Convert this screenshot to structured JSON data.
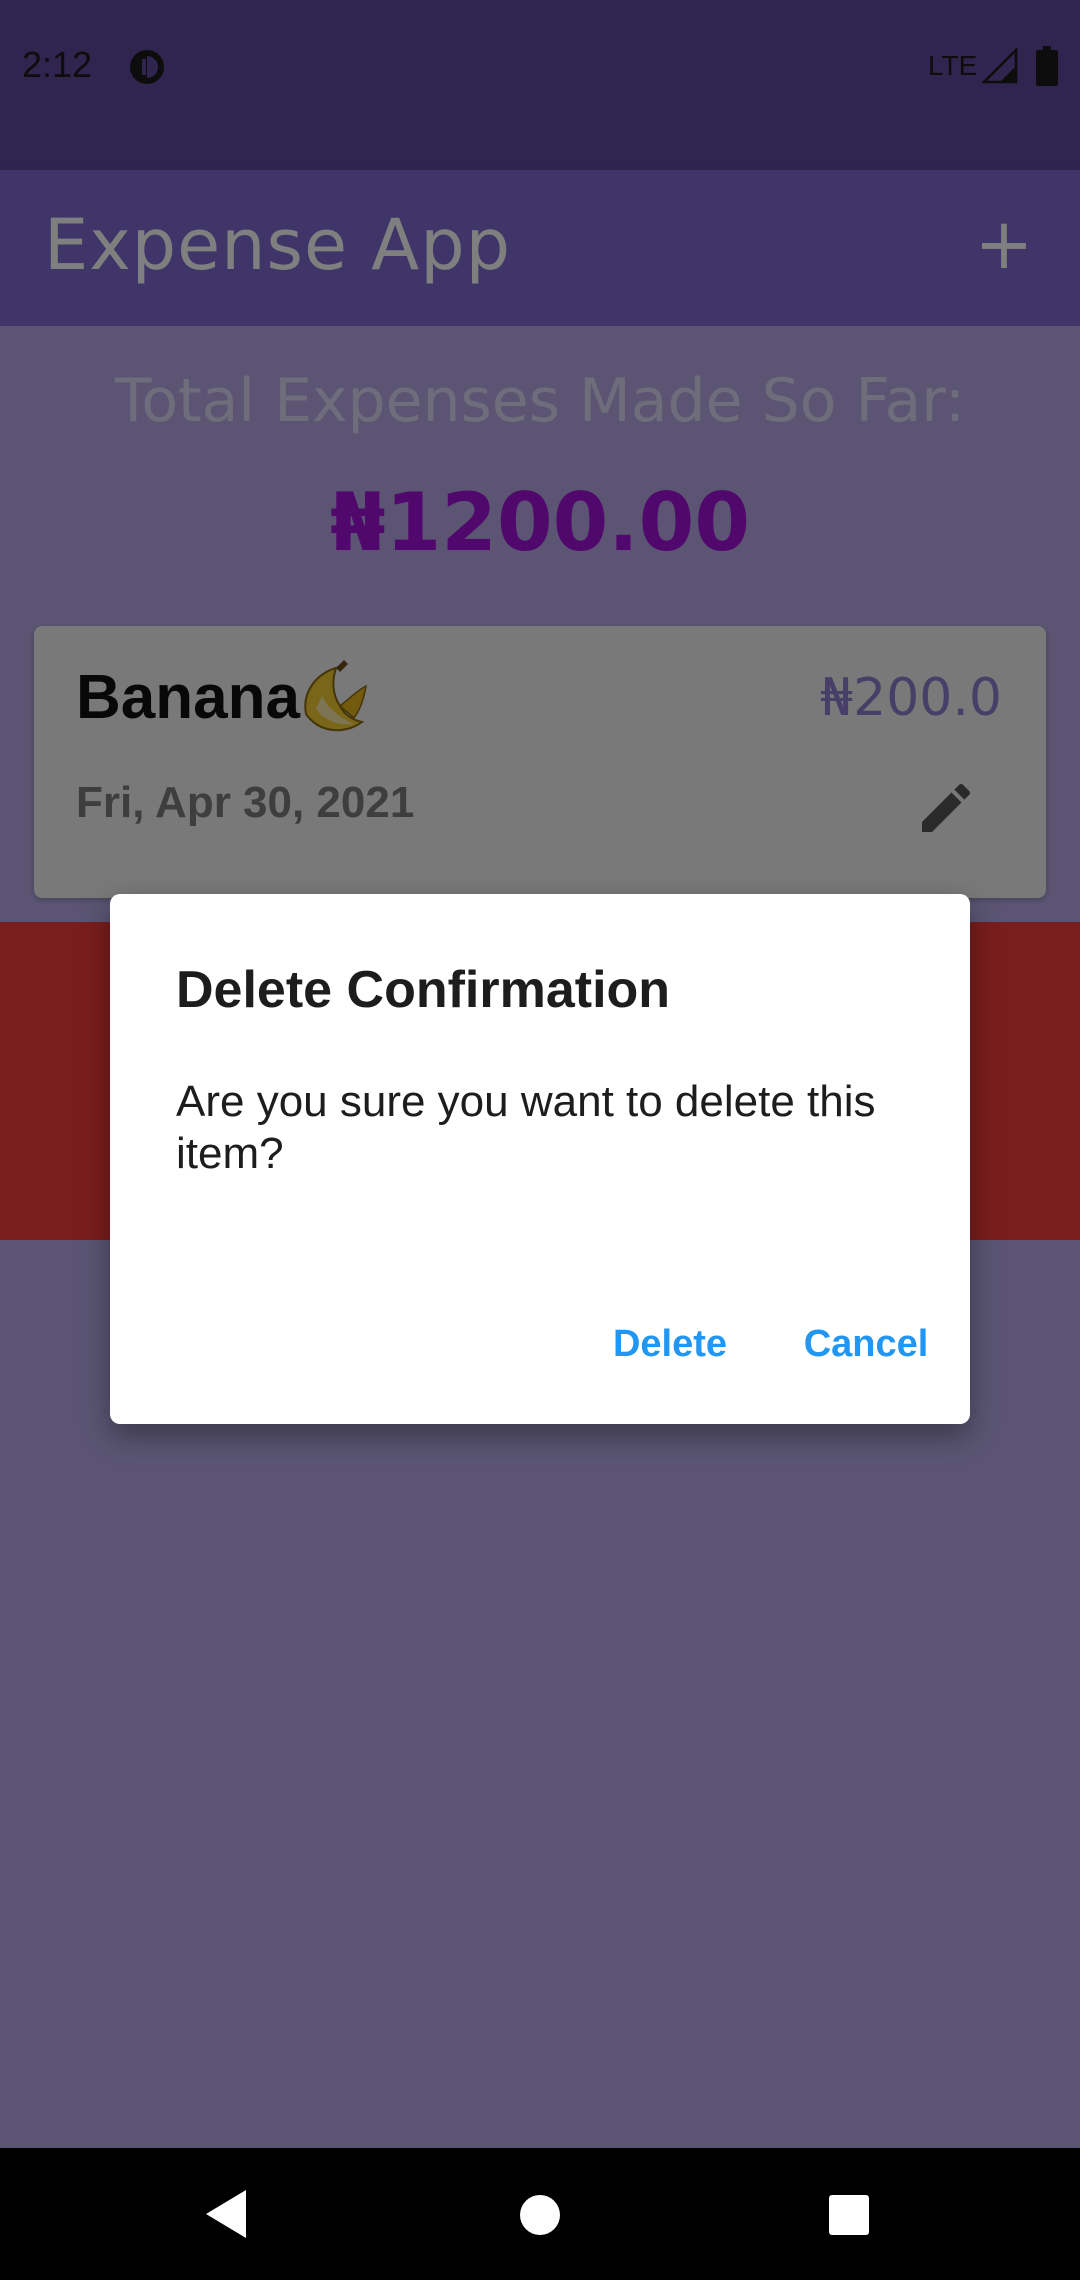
{
  "status_bar": {
    "time": "2:12",
    "network": "LTE",
    "icons": [
      "app-notification-icon",
      "signal-icon",
      "battery-icon"
    ]
  },
  "app_bar": {
    "title": "Expense App",
    "add_label": "+",
    "add_icon": "plus-icon"
  },
  "summary": {
    "label": "Total Expenses Made So Far:",
    "value": "₦1200.00"
  },
  "expenses": [
    {
      "title": "Banana",
      "emoji_icon": "banana-icon",
      "amount": "₦200.0",
      "date": "Fri, Apr 30, 2021",
      "edit_icon": "pencil-icon"
    }
  ],
  "dialog": {
    "title": "Delete Confirmation",
    "message": "Are you sure you want to delete this item?",
    "delete_label": "Delete",
    "cancel_label": "Cancel"
  },
  "nav_bar": {
    "icons": [
      "back-icon",
      "home-icon",
      "recents-icon"
    ]
  },
  "colors": {
    "app_bar": "#7e6bd1",
    "background": "#b7abe6",
    "total_value": "#a010d8",
    "swipe_delete": "#f23a3a",
    "dialog_button": "#2196f3"
  }
}
